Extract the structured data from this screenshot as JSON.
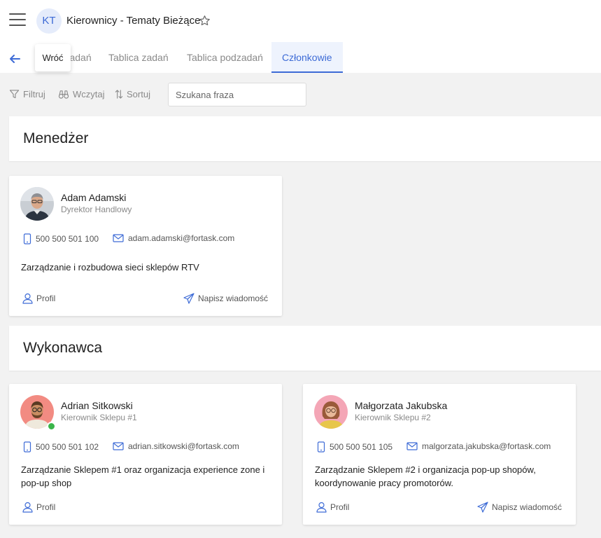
{
  "header": {
    "avatar_initials": "KT",
    "project_title": "Kierownicy - Tematy Bieżące"
  },
  "tabs": [
    {
      "label": "Lista zadań",
      "active": false
    },
    {
      "label": "Tablica zadań",
      "active": false
    },
    {
      "label": "Tablica podzadań",
      "active": false
    },
    {
      "label": "Członkowie",
      "active": true
    }
  ],
  "tooltip": "Wróć",
  "toolbar": {
    "filter_label": "Filtruj",
    "load_label": "Wczytaj",
    "sort_label": "Sortuj",
    "search_placeholder": "Szukana fraza"
  },
  "sections": [
    {
      "title": "Menedżer",
      "members": [
        {
          "name": "Adam Adamski",
          "role": "Dyrektor Handlowy",
          "phone": "500 500 501 100",
          "email": "adam.adamski@fortask.com",
          "description": "Zarządzanie i rozbudowa sieci sklepów RTV",
          "profile_label": "Profil",
          "message_label": "Napisz wiadomość",
          "online": false
        }
      ]
    },
    {
      "title": "Wykonawca",
      "members": [
        {
          "name": "Adrian Sitkowski",
          "role": "Kierownik Sklepu #1",
          "phone": "500 500 501 102",
          "email": "adrian.sitkowski@fortask.com",
          "description": "Zarządzanie Sklepem #1 oraz organizacja experience zone i pop-up shop",
          "profile_label": "Profil",
          "online": true
        },
        {
          "name": "Małgorzata Jakubska",
          "role": "Kierownik Sklepu #2",
          "phone": "500 500 501 105",
          "email": "malgorzata.jakubska@fortask.com",
          "description": "Zarządzanie Sklepem #2 i organizacja pop-up shopów, koordynowanie pracy promotorów.",
          "profile_label": "Profil",
          "message_label": "Napisz wiadomość",
          "online": false
        }
      ]
    }
  ],
  "colors": {
    "accent": "#3d6bd6",
    "online": "#3bb54a",
    "background": "#f2f2f2"
  }
}
